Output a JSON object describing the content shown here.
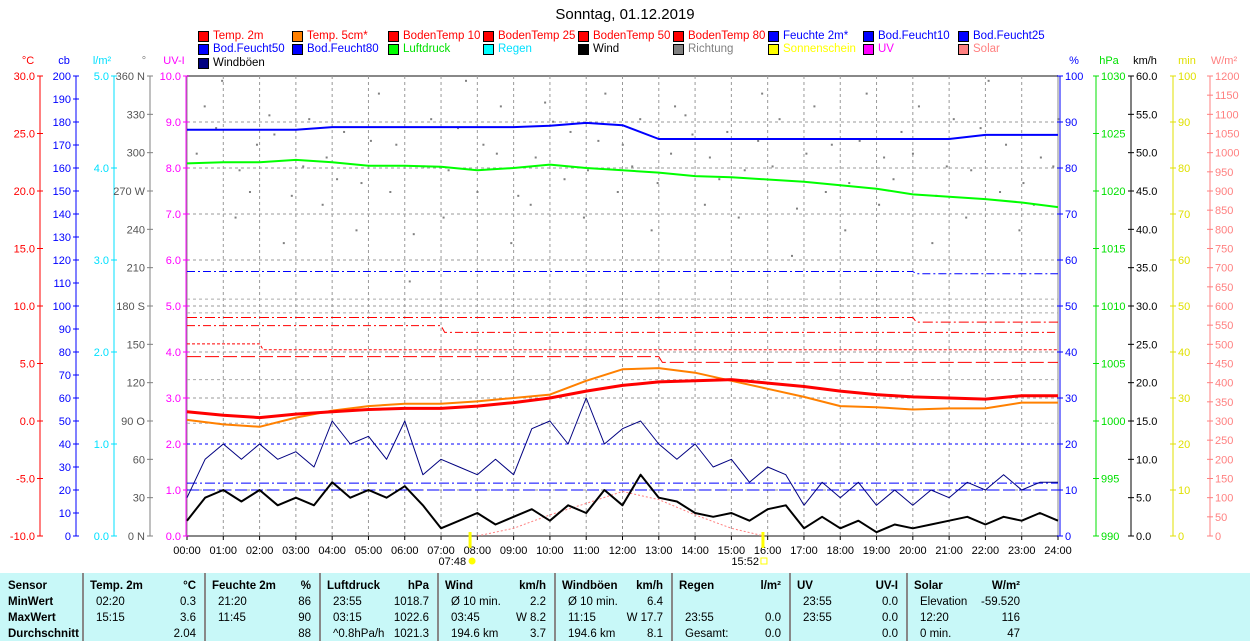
{
  "title": "Sonntag, 01.12.2019",
  "legend": [
    {
      "label": "Temp. 2m",
      "color": "#ff0000",
      "text": "#ff0000"
    },
    {
      "label": "Temp. 5cm*",
      "color": "#ff8000",
      "text": "#ff0000"
    },
    {
      "label": "BodenTemp 10",
      "color": "#ff0000",
      "text": "#ff0000"
    },
    {
      "label": "BodenTemp 25",
      "color": "#ff0000",
      "text": "#ff0000"
    },
    {
      "label": "BodenTemp 50",
      "color": "#ff0000",
      "text": "#ff0000"
    },
    {
      "label": "BodenTemp 80",
      "color": "#ff0000",
      "text": "#ff0000"
    },
    {
      "label": "Feuchte 2m*",
      "color": "#0000ff",
      "text": "#0000ff"
    },
    {
      "label": "Bod.Feucht10",
      "color": "#0000ff",
      "text": "#0000ff"
    },
    {
      "label": "Bod.Feucht25",
      "color": "#0000ff",
      "text": "#0000ff"
    },
    {
      "label": "Bod.Feucht50",
      "color": "#0000ff",
      "text": "#0000ff"
    },
    {
      "label": "Bod.Feucht80",
      "color": "#0000ff",
      "text": "#0000ff"
    },
    {
      "label": "Luftdruck",
      "color": "#00ff00",
      "text": "#00e000"
    },
    {
      "label": "Regen",
      "color": "#00ffff",
      "text": "#00e0ff"
    },
    {
      "label": "Wind",
      "color": "#000000",
      "text": "#000000"
    },
    {
      "label": "Richtung",
      "color": "#808080",
      "text": "#808080"
    },
    {
      "label": "Sonnenschein",
      "color": "#ffff00",
      "text": "#ffff00"
    },
    {
      "label": "UV",
      "color": "#ff00ff",
      "text": "#ff00ff"
    },
    {
      "label": "Solar",
      "color": "#ff8080",
      "text": "#ff8080"
    },
    {
      "label": "Windböen",
      "color": "#000080",
      "text": "#000000"
    }
  ],
  "chart_data": {
    "type": "line",
    "title": "Sonntag, 01.12.2019",
    "x_ticks": [
      "00:00",
      "01:00",
      "02:00",
      "03:00",
      "04:00",
      "05:00",
      "06:00",
      "07:00",
      "08:00",
      "09:00",
      "10:00",
      "11:00",
      "12:00",
      "13:00",
      "14:00",
      "15:00",
      "16:00",
      "17:00",
      "18:00",
      "19:00",
      "20:00",
      "21:00",
      "22:00",
      "23:00",
      "24:00"
    ],
    "sunrise": {
      "label": "07:48",
      "hour": 7.8
    },
    "sunset": {
      "label": "15:52",
      "hour": 15.87
    },
    "axes": {
      "temp": {
        "unit": "°C",
        "color": "#ff0000",
        "range": [
          -10,
          30
        ],
        "ticks": [
          "30.0",
          "25.0",
          "20.0",
          "15.0",
          "10.0",
          "5.0",
          "0.0",
          "-5.0",
          "-10.0"
        ]
      },
      "cb": {
        "unit": "cb",
        "color": "#0000ff",
        "range": [
          0,
          200
        ],
        "ticks": [
          "200",
          "190",
          "180",
          "170",
          "160",
          "150",
          "140",
          "130",
          "120",
          "110",
          "100",
          "90",
          "80",
          "70",
          "60",
          "50",
          "40",
          "30",
          "20",
          "10",
          "0"
        ]
      },
      "rain": {
        "unit": "l/m²",
        "color": "#00e0ff",
        "range": [
          0,
          5
        ],
        "ticks": [
          "5.0",
          "4.0",
          "3.0",
          "2.0",
          "1.0",
          "0.0"
        ]
      },
      "dir": {
        "unit": "°",
        "color": "#808080",
        "range": [
          0,
          360
        ],
        "ticks": [
          "360 N",
          "330",
          "300",
          "270 W",
          "240",
          "210",
          "180 S",
          "150",
          "120",
          "90 O",
          "60",
          "30",
          "0 N"
        ]
      },
      "uvi": {
        "unit": "UV-I",
        "color": "#ff00ff",
        "range": [
          0,
          10
        ],
        "ticks": [
          "10.0",
          "9.0",
          "8.0",
          "7.0",
          "6.0",
          "5.0",
          "4.0",
          "3.0",
          "2.0",
          "1.0",
          "0.0"
        ]
      },
      "hum": {
        "unit": "%",
        "color": "#0000ff",
        "range": [
          0,
          100
        ],
        "ticks": [
          "100",
          "90",
          "80",
          "70",
          "60",
          "50",
          "40",
          "30",
          "20",
          "10",
          "0"
        ]
      },
      "press": {
        "unit": "hPa",
        "color": "#00e000",
        "range": [
          990,
          1030
        ],
        "ticks": [
          "1030",
          "1025",
          "1020",
          "1015",
          "1010",
          "1005",
          "1000",
          "995",
          "990"
        ]
      },
      "wind": {
        "unit": "km/h",
        "color": "#000000",
        "range": [
          0,
          60
        ],
        "ticks": [
          "60.0",
          "55.0",
          "50.0",
          "45.0",
          "40.0",
          "35.0",
          "30.0",
          "25.0",
          "20.0",
          "15.0",
          "10.0",
          "5.0",
          "0.0"
        ]
      },
      "sun": {
        "unit": "min",
        "color": "#e0e000",
        "range": [
          0,
          100
        ],
        "ticks": [
          "100",
          "90",
          "80",
          "70",
          "60",
          "50",
          "40",
          "30",
          "20",
          "10",
          "0"
        ]
      },
      "solar": {
        "unit": "W/m²",
        "color": "#ff8080",
        "range": [
          0,
          1200
        ],
        "ticks": [
          "1200",
          "1150",
          "1100",
          "1050",
          "1000",
          "950",
          "900",
          "850",
          "800",
          "750",
          "700",
          "650",
          "600",
          "550",
          "500",
          "450",
          "400",
          "350",
          "300",
          "250",
          "200",
          "150",
          "100",
          "50",
          "0"
        ]
      }
    },
    "series": [
      {
        "name": "BodenTemp 10",
        "axis": "temp",
        "color": "#ff0000",
        "width": 1,
        "dash": "8 3 2 3",
        "x": [
          0,
          7,
          7.1,
          24
        ],
        "values": [
          8.3,
          8.3,
          7.7,
          7.7
        ]
      },
      {
        "name": "BodenTemp 25",
        "axis": "temp",
        "color": "#ff0000",
        "width": 1,
        "dash": "3 2",
        "x": [
          0,
          2,
          2.1,
          13,
          13.1,
          24
        ],
        "values": [
          6.7,
          6.7,
          6.2,
          6.2,
          6.2,
          6.2
        ]
      },
      {
        "name": "BodenTemp 50",
        "axis": "temp",
        "color": "#ff0000",
        "width": 1,
        "dash": "14 4",
        "x": [
          0,
          13,
          13.1,
          24
        ],
        "values": [
          5.6,
          5.6,
          5.1,
          5.1
        ]
      },
      {
        "name": "BodenTemp 80",
        "axis": "temp",
        "color": "#ff0000",
        "width": 1,
        "dash": "10 3 2 3",
        "x": [
          0,
          20,
          20.1,
          24
        ],
        "values": [
          9.0,
          9.0,
          8.6,
          8.6
        ]
      },
      {
        "name": "Bod.Feucht10",
        "axis": "hum",
        "color": "#0000ff",
        "width": 1,
        "dash": "3 3",
        "x": [
          0,
          24
        ],
        "values": [
          20,
          20
        ]
      },
      {
        "name": "Bod.Feucht25",
        "axis": "hum",
        "color": "#0000ff",
        "width": 1,
        "dash": "8 3 2 3",
        "x": [
          0,
          20,
          20.1,
          24
        ],
        "values": [
          57.5,
          57.5,
          57,
          57
        ]
      },
      {
        "name": "Bod.Feucht50",
        "axis": "hum",
        "color": "#0000ff",
        "width": 1,
        "dash": "12 4",
        "x": [
          0,
          24
        ],
        "values": [
          10,
          10
        ]
      },
      {
        "name": "Bod.Feucht80",
        "axis": "hum",
        "color": "#0000ff",
        "width": 1,
        "dash": "10 3 2 3",
        "x": [
          0,
          24
        ],
        "values": [
          11.5,
          11.5
        ]
      },
      {
        "name": "Solar",
        "axis": "solar",
        "color": "#ff8080",
        "width": 1,
        "dash": "2 2",
        "x": [
          8,
          9,
          10,
          11,
          12,
          13,
          14,
          15,
          15.9
        ],
        "values": [
          0,
          20,
          55,
          85,
          116,
          95,
          55,
          20,
          0
        ]
      },
      {
        "name": "Windböen",
        "axis": "wind",
        "color": "#000080",
        "width": 1,
        "x": "half",
        "values": [
          5,
          10,
          12,
          10,
          12,
          10,
          11,
          9,
          15,
          12,
          13,
          10,
          15,
          8,
          10,
          9,
          8,
          10,
          8,
          14,
          15,
          12,
          18,
          12,
          14,
          15,
          12,
          10,
          12,
          9,
          10,
          7,
          9,
          8,
          4,
          7,
          5,
          7,
          4,
          6,
          4,
          6,
          5,
          7,
          6,
          8,
          6,
          7,
          7
        ]
      },
      {
        "name": "Wind",
        "axis": "wind",
        "color": "#000000",
        "width": 2,
        "x": "half",
        "values": [
          2,
          5,
          6,
          4.5,
          6,
          4,
          5,
          4,
          7,
          5,
          6,
          5,
          6.5,
          4,
          1,
          2,
          3,
          1.5,
          2.5,
          3.5,
          2,
          4,
          3,
          6,
          4,
          8,
          5,
          4.5,
          3,
          2.5,
          3,
          2,
          3.5,
          4,
          1,
          2.5,
          1,
          2,
          0.5,
          1.5,
          1,
          1.5,
          2,
          2.5,
          1.5,
          2.5,
          2,
          3,
          2
        ]
      },
      {
        "name": "Temp. 5cm*",
        "axis": "temp",
        "color": "#ff8000",
        "width": 2,
        "x": "hour",
        "values": [
          0.1,
          -0.3,
          -0.5,
          0.3,
          0.9,
          1.3,
          1.5,
          1.5,
          1.7,
          2.0,
          2.3,
          3.5,
          4.5,
          4.6,
          4.2,
          3.5,
          2.8,
          2.1,
          1.3,
          1.2,
          1.0,
          1.1,
          1.1,
          1.6,
          1.6
        ]
      },
      {
        "name": "Temp. 2m",
        "axis": "temp",
        "color": "#ff0000",
        "width": 3,
        "x": "hour",
        "values": [
          0.8,
          0.5,
          0.3,
          0.6,
          0.8,
          1.0,
          1.1,
          1.1,
          1.3,
          1.6,
          2.0,
          2.6,
          3.1,
          3.4,
          3.5,
          3.6,
          3.3,
          3.0,
          2.6,
          2.3,
          2.1,
          2.0,
          1.9,
          2.2,
          2.2
        ]
      },
      {
        "name": "Luftdruck",
        "axis": "press",
        "color": "#00ff00",
        "width": 2,
        "x": "hour",
        "values": [
          1022.4,
          1022.5,
          1022.5,
          1022.7,
          1022.5,
          1022.2,
          1022.2,
          1022.1,
          1021.8,
          1022.0,
          1022.3,
          1022.0,
          1021.8,
          1021.6,
          1021.3,
          1021.2,
          1021.0,
          1020.8,
          1020.5,
          1020.2,
          1019.7,
          1019.5,
          1019.3,
          1019.0,
          1018.6
        ]
      },
      {
        "name": "Feuchte 2m*",
        "axis": "hum",
        "color": "#0000ff",
        "width": 2,
        "x": "hour",
        "values": [
          88.3,
          88.3,
          88.3,
          88.3,
          88.9,
          88.9,
          88.9,
          88.9,
          88.9,
          88.9,
          89.2,
          89.8,
          89.3,
          86.3,
          86.3,
          86.3,
          86.3,
          86.3,
          86.3,
          86.3,
          86.3,
          86.3,
          87.2,
          87.2,
          87.2
        ]
      }
    ],
    "direction_points": [
      300,
      320,
      250,
      270,
      330,
      230,
      290,
      260,
      280,
      240,
      310,
      270,
      200,
      290,
      250,
      320,
      270,
      300,
      230,
      260,
      340,
      280,
      250,
      310,
      270,
      290,
      240,
      300,
      330,
      260,
      280,
      250,
      310,
      290,
      220,
      300,
      270,
      240,
      310,
      260,
      280,
      300,
      230,
      290,
      250,
      320,
      270,
      240,
      260,
      290
    ]
  },
  "table": {
    "rows": [
      "Sensor",
      "MinWert",
      "MaxWert",
      "Durchschnitt"
    ],
    "cols": [
      {
        "h1": "Temp. 2m",
        "h2": "°C",
        "a": [
          "02:20",
          "15:15",
          ""
        ],
        "b": [
          "0.3",
          "3.6",
          "2.04"
        ]
      },
      {
        "h1": "Feuchte 2m",
        "h2": "%",
        "a": [
          "21:20",
          "11:45",
          ""
        ],
        "b": [
          "86",
          "90",
          "88"
        ]
      },
      {
        "h1": "Luftdruck",
        "h2": "hPa",
        "a": [
          "23:55",
          "03:15",
          "^0.8hPa/h"
        ],
        "b": [
          "1018.7",
          "1022.6",
          "1021.3"
        ]
      },
      {
        "h1": "Wind",
        "h2": "km/h",
        "a": [
          "Ø 10 min.",
          "03:45",
          "194.6 km"
        ],
        "b": [
          "2.2",
          "W 8.2",
          "3.7"
        ]
      },
      {
        "h1": "Windböen",
        "h2": "km/h",
        "a": [
          "Ø 10 min.",
          "11:15",
          "194.6 km"
        ],
        "b": [
          "6.4",
          "W 17.7",
          "8.1"
        ]
      },
      {
        "h1": "Regen",
        "h2": "l/m²",
        "a": [
          "",
          "23:55",
          "Gesamt:"
        ],
        "b": [
          "",
          "0.0",
          "0.0"
        ]
      },
      {
        "h1": "UV",
        "h2": "UV-I",
        "a": [
          "23:55",
          "23:55",
          ""
        ],
        "b": [
          "0.0",
          "0.0",
          "0.0"
        ]
      },
      {
        "h1": "Solar",
        "h2": "W/m²",
        "a": [
          "Elevation",
          "12:20",
          "0 min."
        ],
        "b": [
          "-59.520",
          "116",
          "47"
        ]
      }
    ]
  }
}
